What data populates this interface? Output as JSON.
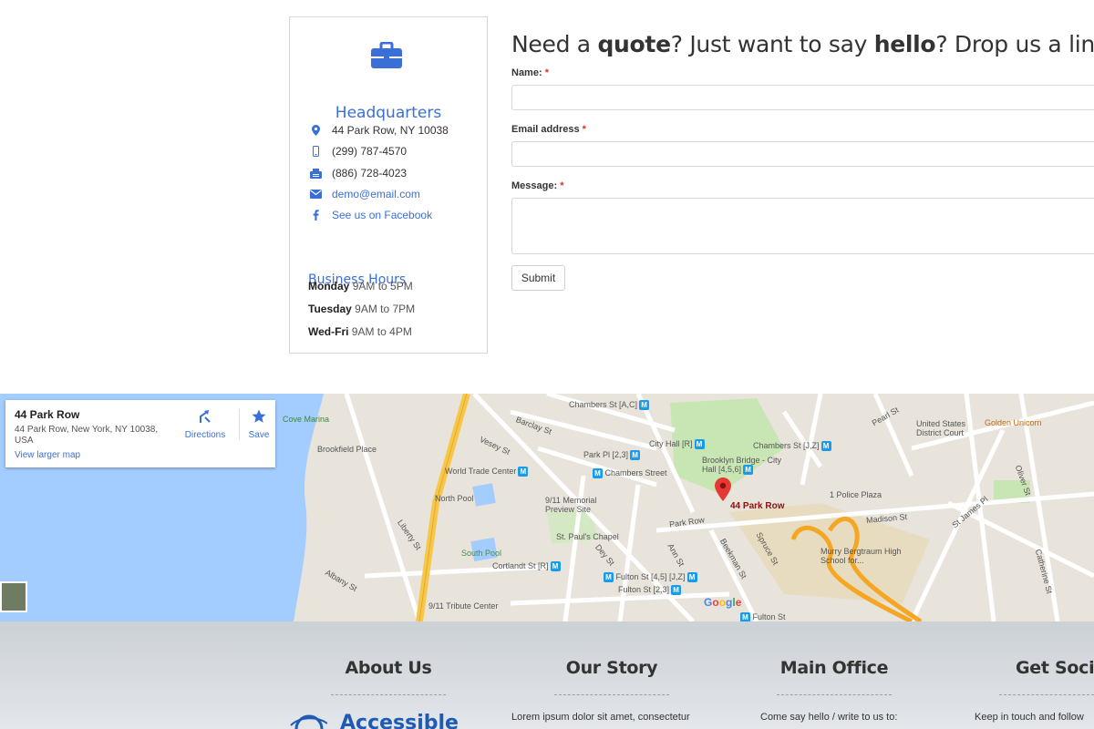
{
  "headquarters": {
    "title": "Headquarters",
    "address": "44 Park Row, NY 10038",
    "phone": "(299) 787-4570",
    "fax": "(886) 728-4023",
    "email": "demo@email.com",
    "facebook": "See us on Facebook"
  },
  "business_hours": {
    "title": "Business Hours",
    "rows": [
      {
        "day": "Monday",
        "hours": "9AM to 5PM"
      },
      {
        "day": "Tuesday",
        "hours": "9AM to 7PM"
      },
      {
        "day": "Wed-Fri",
        "hours": "9AM to 4PM"
      }
    ]
  },
  "form": {
    "heading_parts": [
      "Need a ",
      "quote",
      "? Just want to say ",
      "hello",
      "? Drop us a line!"
    ],
    "name_label": "Name:",
    "email_label": "Email address",
    "message_label": "Message:",
    "required_mark": "*",
    "submit_label": "Submit"
  },
  "map": {
    "place_name": "44 Park Row",
    "place_address": "44 Park Row, New York, NY 10038, USA",
    "larger_map": "View larger map",
    "directions": "Directions",
    "save": "Save",
    "pin_label": "44 Park Row",
    "google": "Google",
    "metro_glyph": "M",
    "labels": {
      "chambers_ac": "Chambers St [A,C]",
      "city_hall_r": "City Hall [R]",
      "chambers_jz": "Chambers St [J,Z]",
      "brooklyn_bridge": "Brooklyn Bridge - City Hall [4,5,6]",
      "park_pl": "Park Pl [2,3]",
      "chambers_street": "Chambers Street",
      "world_trade_center": "World Trade Center",
      "north_pool": "North Pool",
      "south_pool": "South Pool",
      "memorial": "9/11 Memorial Preview Site",
      "st_pauls": "St. Paul's Chapel",
      "cortlandt": "Cortlandt St [R]",
      "fulton_45": "Fulton St [4,5] [J,Z]",
      "fulton_23": "Fulton St [2,3]",
      "tribute": "9/11 Tribute Center",
      "brookfield": "Brookfield Place",
      "cove_marina": "Cove Marina",
      "police_plaza": "1 Police Plaza",
      "murry": "Murry Bergtraum High School for...",
      "us_court": "United States District Court",
      "golden_unicorn": "Golden Unicorn",
      "park_row": "Park Row",
      "madison": "Madison St",
      "pearl": "Pearl St",
      "liberty": "Liberty St",
      "albany": "Albany St",
      "barclay": "Barclay St",
      "vesey": "Vesey St",
      "dey": "Dey St",
      "ann": "Ann St",
      "beekman": "Beekman St",
      "spruce": "Spruce St",
      "st_james": "St James Pl",
      "oliver": "Oliver St",
      "catherine": "Catherine St",
      "fulton_st2": "Fulton St"
    }
  },
  "footer": {
    "columns": [
      {
        "title": "About Us",
        "text": ""
      },
      {
        "title": "Our Story",
        "text": "Lorem ipsum dolor sit amet, consectetur"
      },
      {
        "title": "Main Office",
        "text": "Come say hello / write to us to:"
      },
      {
        "title": "Get Social",
        "text": "Keep in touch and follow"
      }
    ],
    "logo_text": "Accessible"
  },
  "colors": {
    "accent": "#3b6fd8",
    "required": "#d9302c",
    "water": "#a3ccff",
    "highway": "#f7c74a",
    "park": "#c8e6b4"
  }
}
